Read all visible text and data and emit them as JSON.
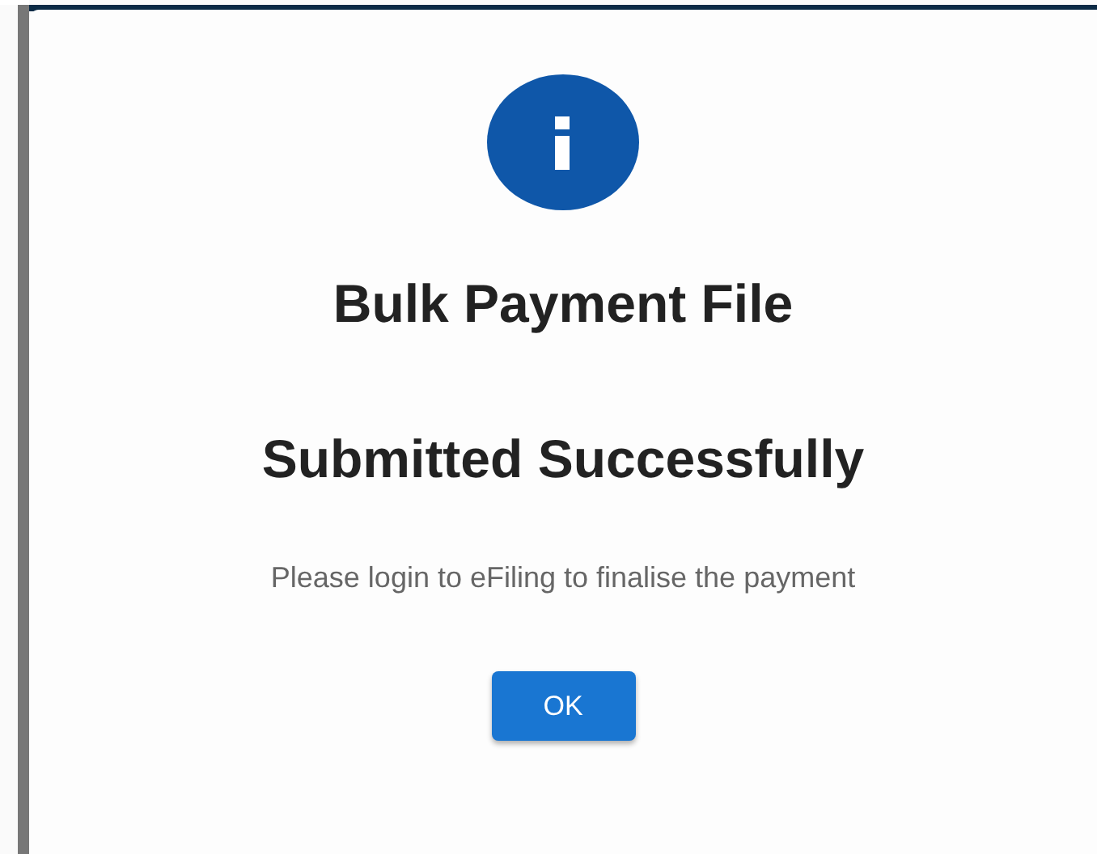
{
  "dialog": {
    "title_lines": [
      "Bulk Payment File",
      "Submitted Successfully"
    ],
    "message": "Please login to eFiling to finalise the payment",
    "buttons": [
      "OK"
    ]
  }
}
